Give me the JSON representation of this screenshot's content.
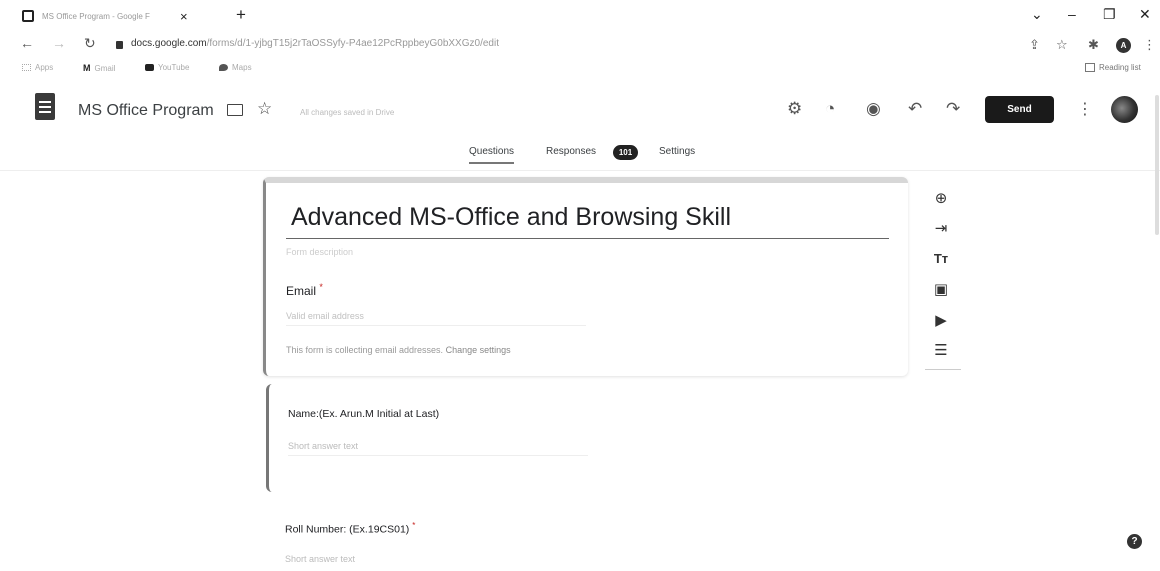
{
  "browser": {
    "tab_title": "MS Office Program - Google F",
    "url_domain": "docs.google.com",
    "url_path": "/forms/d/1-yjbgT15j2rTaOSSyfy-P4ae12PcRppbeyG0bXXGz0/edit",
    "bookmarks": [
      "Apps",
      "Gmail",
      "YouTube",
      "Maps"
    ],
    "reading_list": "Reading list",
    "profile_initial": "A"
  },
  "header": {
    "title": "MS Office Program",
    "saved_status": "All changes saved in Drive",
    "send_label": "Send"
  },
  "tabs": {
    "questions": "Questions",
    "responses": "Responses",
    "responses_count": "101",
    "settings": "Settings"
  },
  "form": {
    "title": "Advanced MS-Office and Browsing Skill",
    "description_placeholder": "Form description",
    "email_label": "Email",
    "email_required": "*",
    "email_placeholder": "Valid email address",
    "collect_note": "This form is collecting email addresses.",
    "change_settings": "Change settings"
  },
  "questions": [
    {
      "label": "Name:(Ex. Arun.M  Initial at Last)",
      "required": "",
      "placeholder": "Short answer text"
    },
    {
      "label": "Roll Number: (Ex.19CS01)",
      "required": "*",
      "placeholder": "Short answer text"
    }
  ],
  "toolbar_icons": [
    "add-question-icon",
    "import-questions-icon",
    "add-title-icon",
    "add-image-icon",
    "add-video-icon",
    "add-section-icon"
  ],
  "colors": {
    "send_button": "#1a1a1a",
    "required_star": "#c5221f"
  }
}
